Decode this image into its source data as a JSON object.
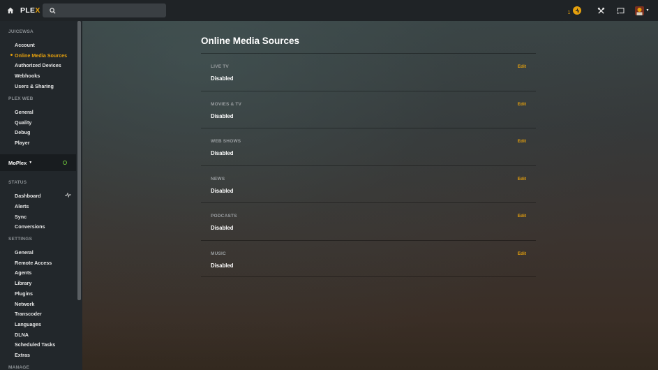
{
  "header": {
    "logo_main": "PLE",
    "logo_accent": "X",
    "search_placeholder": "",
    "notification_count": "1"
  },
  "sidebar": {
    "account_heading": "JUICEWSA",
    "account_items": [
      "Account",
      "Online Media Sources",
      "Authorized Devices",
      "Webhooks",
      "Users & Sharing"
    ],
    "plexweb_heading": "PLEX WEB",
    "plexweb_items": [
      "General",
      "Quality",
      "Debug",
      "Player"
    ],
    "server_name": "MoPlex",
    "status_heading": "STATUS",
    "status_items": [
      "Dashboard",
      "Alerts",
      "Sync",
      "Conversions"
    ],
    "settings_heading": "SETTINGS",
    "settings_items": [
      "General",
      "Remote Access",
      "Agents",
      "Library",
      "Plugins",
      "Network",
      "Transcoder",
      "Languages",
      "DLNA",
      "Scheduled Tasks",
      "Extras"
    ],
    "manage_heading": "MANAGE"
  },
  "main": {
    "title": "Online Media Sources",
    "sources": [
      {
        "label": "LIVE TV",
        "status": "Disabled",
        "edit": "Edit"
      },
      {
        "label": "MOVIES & TV",
        "status": "Disabled",
        "edit": "Edit"
      },
      {
        "label": "WEB SHOWS",
        "status": "Disabled",
        "edit": "Edit"
      },
      {
        "label": "NEWS",
        "status": "Disabled",
        "edit": "Edit"
      },
      {
        "label": "PODCASTS",
        "status": "Disabled",
        "edit": "Edit"
      },
      {
        "label": "MUSIC",
        "status": "Disabled",
        "edit": "Edit"
      }
    ]
  },
  "colors": {
    "accent": "#e5a00d",
    "topbar": "#1f2326",
    "sidebar": "#22272b",
    "online": "#6bbf3b"
  }
}
